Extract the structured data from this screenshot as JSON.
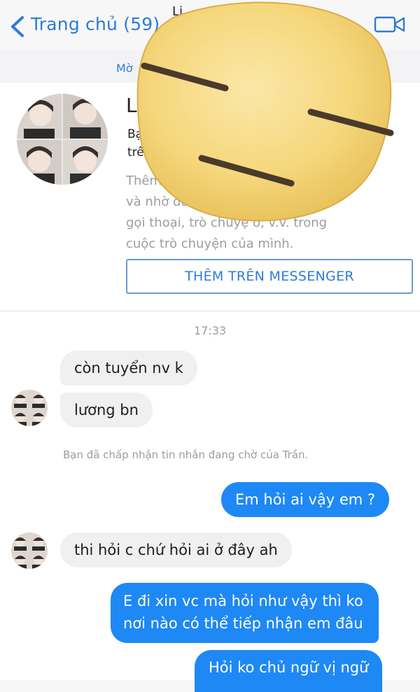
{
  "header": {
    "back_label": "Trang chủ (59)",
    "partial_name": "Li",
    "icons": [
      "back-chevron-icon",
      "phone-icon",
      "video-camera-icon"
    ]
  },
  "subheader": {
    "label": "Mờ"
  },
  "profile": {
    "name_initial": "L",
    "info_line1": "Bạ",
    "info_line2": "trê",
    "description": [
      "Thêm                                          ể  bạn",
      "và nhờ đó                              ận tiền,",
      "gọi thoại, trò chuyệ        o, v.v. trong",
      "cuộc trò chuyện của mình."
    ],
    "messenger_button": "THÊM TRÊN MESSENGER"
  },
  "chat": {
    "timestamp": "17:33",
    "messages": [
      {
        "dir": "in",
        "text": "còn tuyển nv k"
      },
      {
        "dir": "in",
        "text": "lương bn"
      },
      {
        "dir": "out",
        "text": "Em hỏi ai vậy em ?"
      },
      {
        "dir": "in",
        "text": "thi hỏi c chứ hỏi ai ở đây ah"
      },
      {
        "dir": "out",
        "lines": [
          "E đi xin vc mà hỏi như vậy thì ko",
          "nơi nào có thể tiếp nhận em đâu"
        ]
      },
      {
        "dir": "out",
        "text": "Hỏi ko chủ ngữ vị ngữ"
      }
    ],
    "system_note": "Bạn đã chấp nhận tin nhắn đang chờ của Trần."
  },
  "colors": {
    "accent": "#2d7cd3",
    "outgoing_bubble": "#1e88f5",
    "incoming_bubble": "#f1f0f0",
    "muted_text": "#9a9da3"
  },
  "overlay": {
    "icon": "expressionless-face-emoji"
  }
}
